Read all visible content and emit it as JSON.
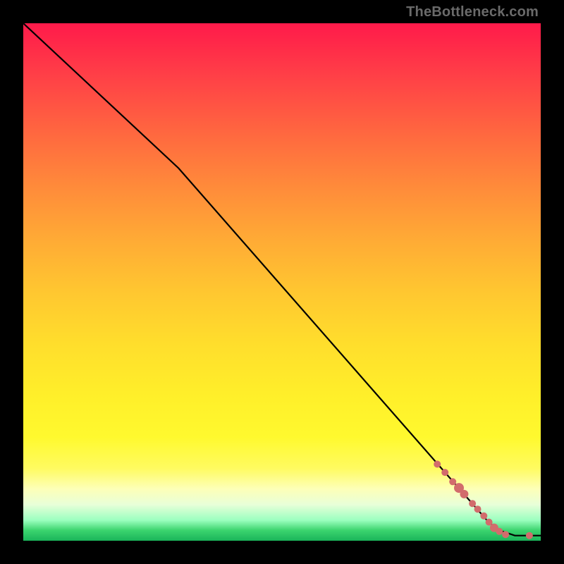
{
  "watermark": "TheBottleneck.com",
  "chart_data": {
    "type": "line",
    "title": "",
    "xlabel": "",
    "ylabel": "",
    "xlim": [
      0,
      100
    ],
    "ylim": [
      0,
      100
    ],
    "line": {
      "name": "bottleneck-curve",
      "points": [
        {
          "x": 0.0,
          "y": 100.0
        },
        {
          "x": 30.0,
          "y": 72.0
        },
        {
          "x": 90.0,
          "y": 3.5
        },
        {
          "x": 92.0,
          "y": 2.0
        },
        {
          "x": 95.0,
          "y": 1.0
        },
        {
          "x": 100.0,
          "y": 1.0
        }
      ],
      "color": "#000000",
      "width": 2.2
    },
    "markers": {
      "name": "data-points",
      "color": "#d26c6c",
      "points": [
        {
          "x": 80.0,
          "y": 14.8,
          "r": 5
        },
        {
          "x": 81.5,
          "y": 13.2,
          "r": 5
        },
        {
          "x": 83.0,
          "y": 11.4,
          "r": 5
        },
        {
          "x": 84.2,
          "y": 10.2,
          "r": 7
        },
        {
          "x": 85.2,
          "y": 9.0,
          "r": 6
        },
        {
          "x": 86.8,
          "y": 7.2,
          "r": 5
        },
        {
          "x": 87.8,
          "y": 6.1,
          "r": 5
        },
        {
          "x": 89.0,
          "y": 4.8,
          "r": 5
        },
        {
          "x": 90.0,
          "y": 3.6,
          "r": 5
        },
        {
          "x": 91.0,
          "y": 2.5,
          "r": 6
        },
        {
          "x": 92.0,
          "y": 1.8,
          "r": 5
        },
        {
          "x": 93.2,
          "y": 1.2,
          "r": 5
        },
        {
          "x": 97.8,
          "y": 1.0,
          "r": 5
        }
      ]
    }
  }
}
